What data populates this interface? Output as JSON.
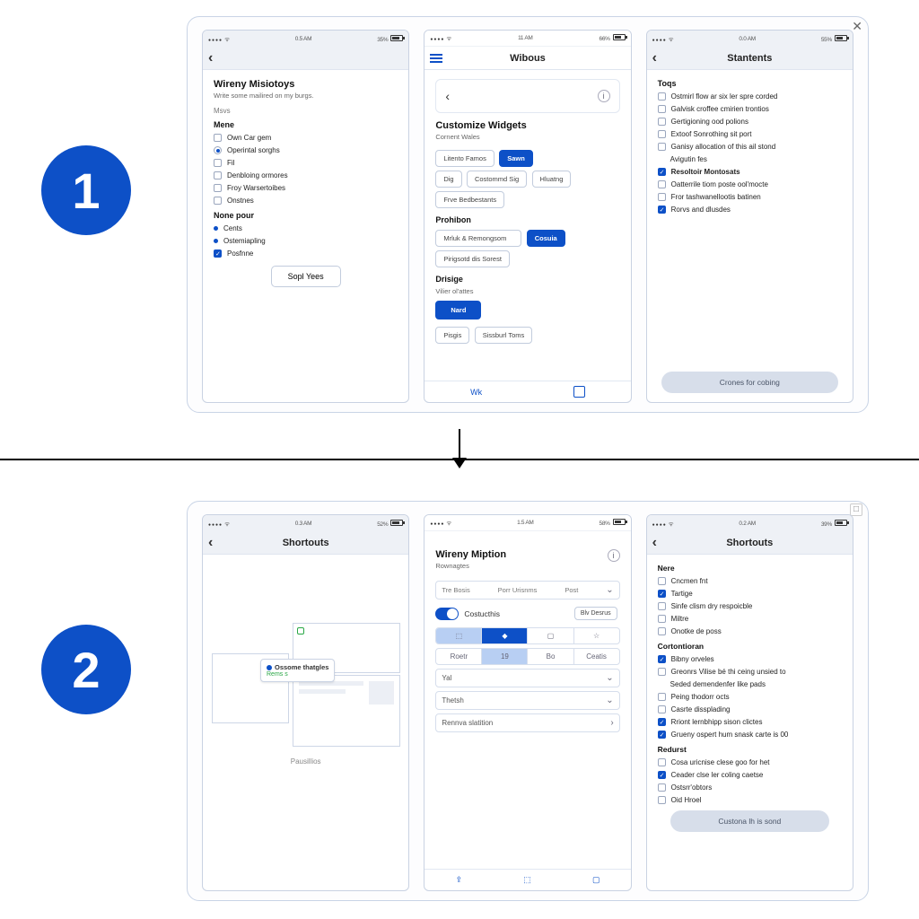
{
  "step1_label": "1",
  "step2_label": "2",
  "row1": {
    "phoneA": {
      "status": {
        "carrier": "•••• ᯤ",
        "time": "0.5 AM",
        "batt": "35%"
      },
      "title": "Wireny Misiotoys",
      "subtitle": "Write some mailired on my burgs.",
      "group1": "Msvs",
      "group1b": "Mene",
      "opts1": [
        "Own Car gem",
        "Operintal sorghs",
        "Fil",
        "Denbloing ormores",
        "Froy Warsertoibes",
        "Onstnes"
      ],
      "group2": "None pour",
      "opts2": [
        "Cents",
        "Ostemiapling",
        "Posfnne"
      ],
      "submit": "Sopl Yees"
    },
    "phoneB": {
      "status": {
        "carrier": "•••• ᯤ",
        "time": "11 AM",
        "batt": "66%"
      },
      "nav": "Wibous",
      "card_title": "Customize Widgets",
      "card_sub": "Cornent Wales",
      "chips1": [
        "Litento Famos",
        "Sawn",
        "Dig",
        "Costommd Sig",
        "Hluatng",
        "Frve Bedbestants"
      ],
      "group_pos": "Prohibon",
      "pos_opts": [
        "Mrluk & Remongsom",
        "Cosuia",
        "Pirigsotd dis Sorest"
      ],
      "group_design": "Drisige",
      "design_sub": "Vilier ol'attes",
      "btn_next": "Nard",
      "footer_chips": [
        "Pisgis",
        "Sissburl Toms"
      ],
      "tab1": "Wk"
    },
    "phoneC": {
      "status": {
        "carrier": "•••• ᯤ",
        "time": "0.0 AM",
        "batt": "55%"
      },
      "nav": "Stantents",
      "group1": "Toqs",
      "opts1": [
        "Ostmirl flow ar six ler spre corded",
        "Galvisk croffee cmirien trontios",
        "Gertigioning ood polions",
        "Extoof Sonrothing sit port",
        "Ganisy allocation of this ail stond",
        "Avigutin fes"
      ],
      "group2": "Resoltoir Montosats",
      "opts2": [
        "Oatterrile tiom poste ool'mocte",
        "Fror tashwanellootis batinen",
        "Rorvs and dlusdes"
      ],
      "cta": "Crones for cobing"
    }
  },
  "row2": {
    "phoneA": {
      "status": {
        "carrier": "•••• ᯤ",
        "time": "0.3 AM",
        "batt": "52%"
      },
      "nav": "Shortouts",
      "tooltip_title": "Ossome thatgles",
      "tooltip_sub": "Rems s",
      "caption": "Pausillios"
    },
    "phoneB": {
      "status": {
        "carrier": "•••• ᯤ",
        "time": "1.5 AM",
        "batt": "58%"
      },
      "title": "Wireny Miption",
      "sub": "Rownagtes",
      "chips": [
        "Tre Bosis",
        "Porr Urisnms",
        "Post"
      ],
      "toggle_label": "Costucthis",
      "toggle_right": "Blv Desrus",
      "seg": [
        "Roetr",
        "19",
        "Bo",
        "Ceatis"
      ],
      "sel1": "Yal",
      "sel2": "Thetsh",
      "sel3": "Rennva slatition"
    },
    "phoneC": {
      "status": {
        "carrier": "•••• ᯤ",
        "time": "0.2 AM",
        "batt": "39%"
      },
      "nav": "Shortouts",
      "g1": "Nere",
      "o1": [
        "Cncmen fnt",
        "Tartige",
        "Sinfe clism dry respoicble",
        "Miltre",
        "Onotke de poss"
      ],
      "g2": "Cortontioran",
      "o2": [
        "Bibny orveles",
        "Greonrs Vilise bé thi ceing unsied to",
        "Seded demendenfer like pads",
        "Peing thodorr octs",
        "Casrte dissplading",
        "Rriont lernbhipp sison clictes",
        "Grueny ospert hum snask carte is 00"
      ],
      "g3": "Redurst",
      "o3": [
        "Cosa uricnise clese goo for het",
        "Ceader clse ler coling caetse",
        "Ostsrr'obtors",
        "Oid Hroel"
      ],
      "cta": "Custona lh is sond"
    }
  }
}
